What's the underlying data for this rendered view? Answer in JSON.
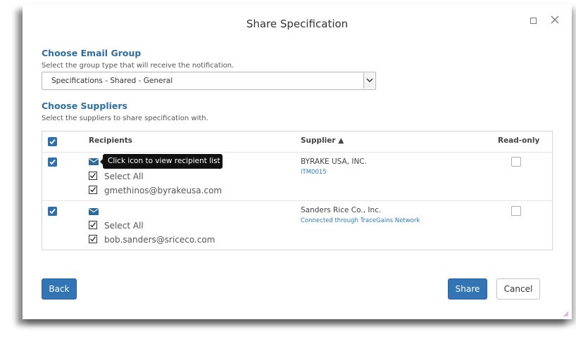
{
  "dialog": {
    "title": "Share Specification",
    "accent_color": "#2f6e9e"
  },
  "email_group": {
    "title": "Choose Email Group",
    "subtitle": "Select the group type that will receive the notification.",
    "selected_value": "Specifications - Shared - General"
  },
  "suppliers_section": {
    "title": "Choose Suppliers",
    "subtitle": "Select the suppliers to share specification with."
  },
  "table": {
    "headers": {
      "recipients": "Recipients",
      "supplier": "Supplier ▲",
      "read_only": "Read-only"
    },
    "rows": [
      {
        "select_all_label": "Select All",
        "email": "gmethinos@byrakeusa.com",
        "supplier_name": "BYRAKE USA, INC.",
        "supplier_sub": "ITM0015"
      },
      {
        "select_all_label": "Select All",
        "email": "bob.sanders@sriceco.com",
        "supplier_name": "Sanders Rice Co., Inc.",
        "supplier_sub": "Connected through TraceGains Network"
      }
    ]
  },
  "tooltip": {
    "text": "Click icon to view recipient list"
  },
  "footer": {
    "back_label": "Back",
    "share_label": "Share",
    "cancel_label": "Cancel"
  }
}
